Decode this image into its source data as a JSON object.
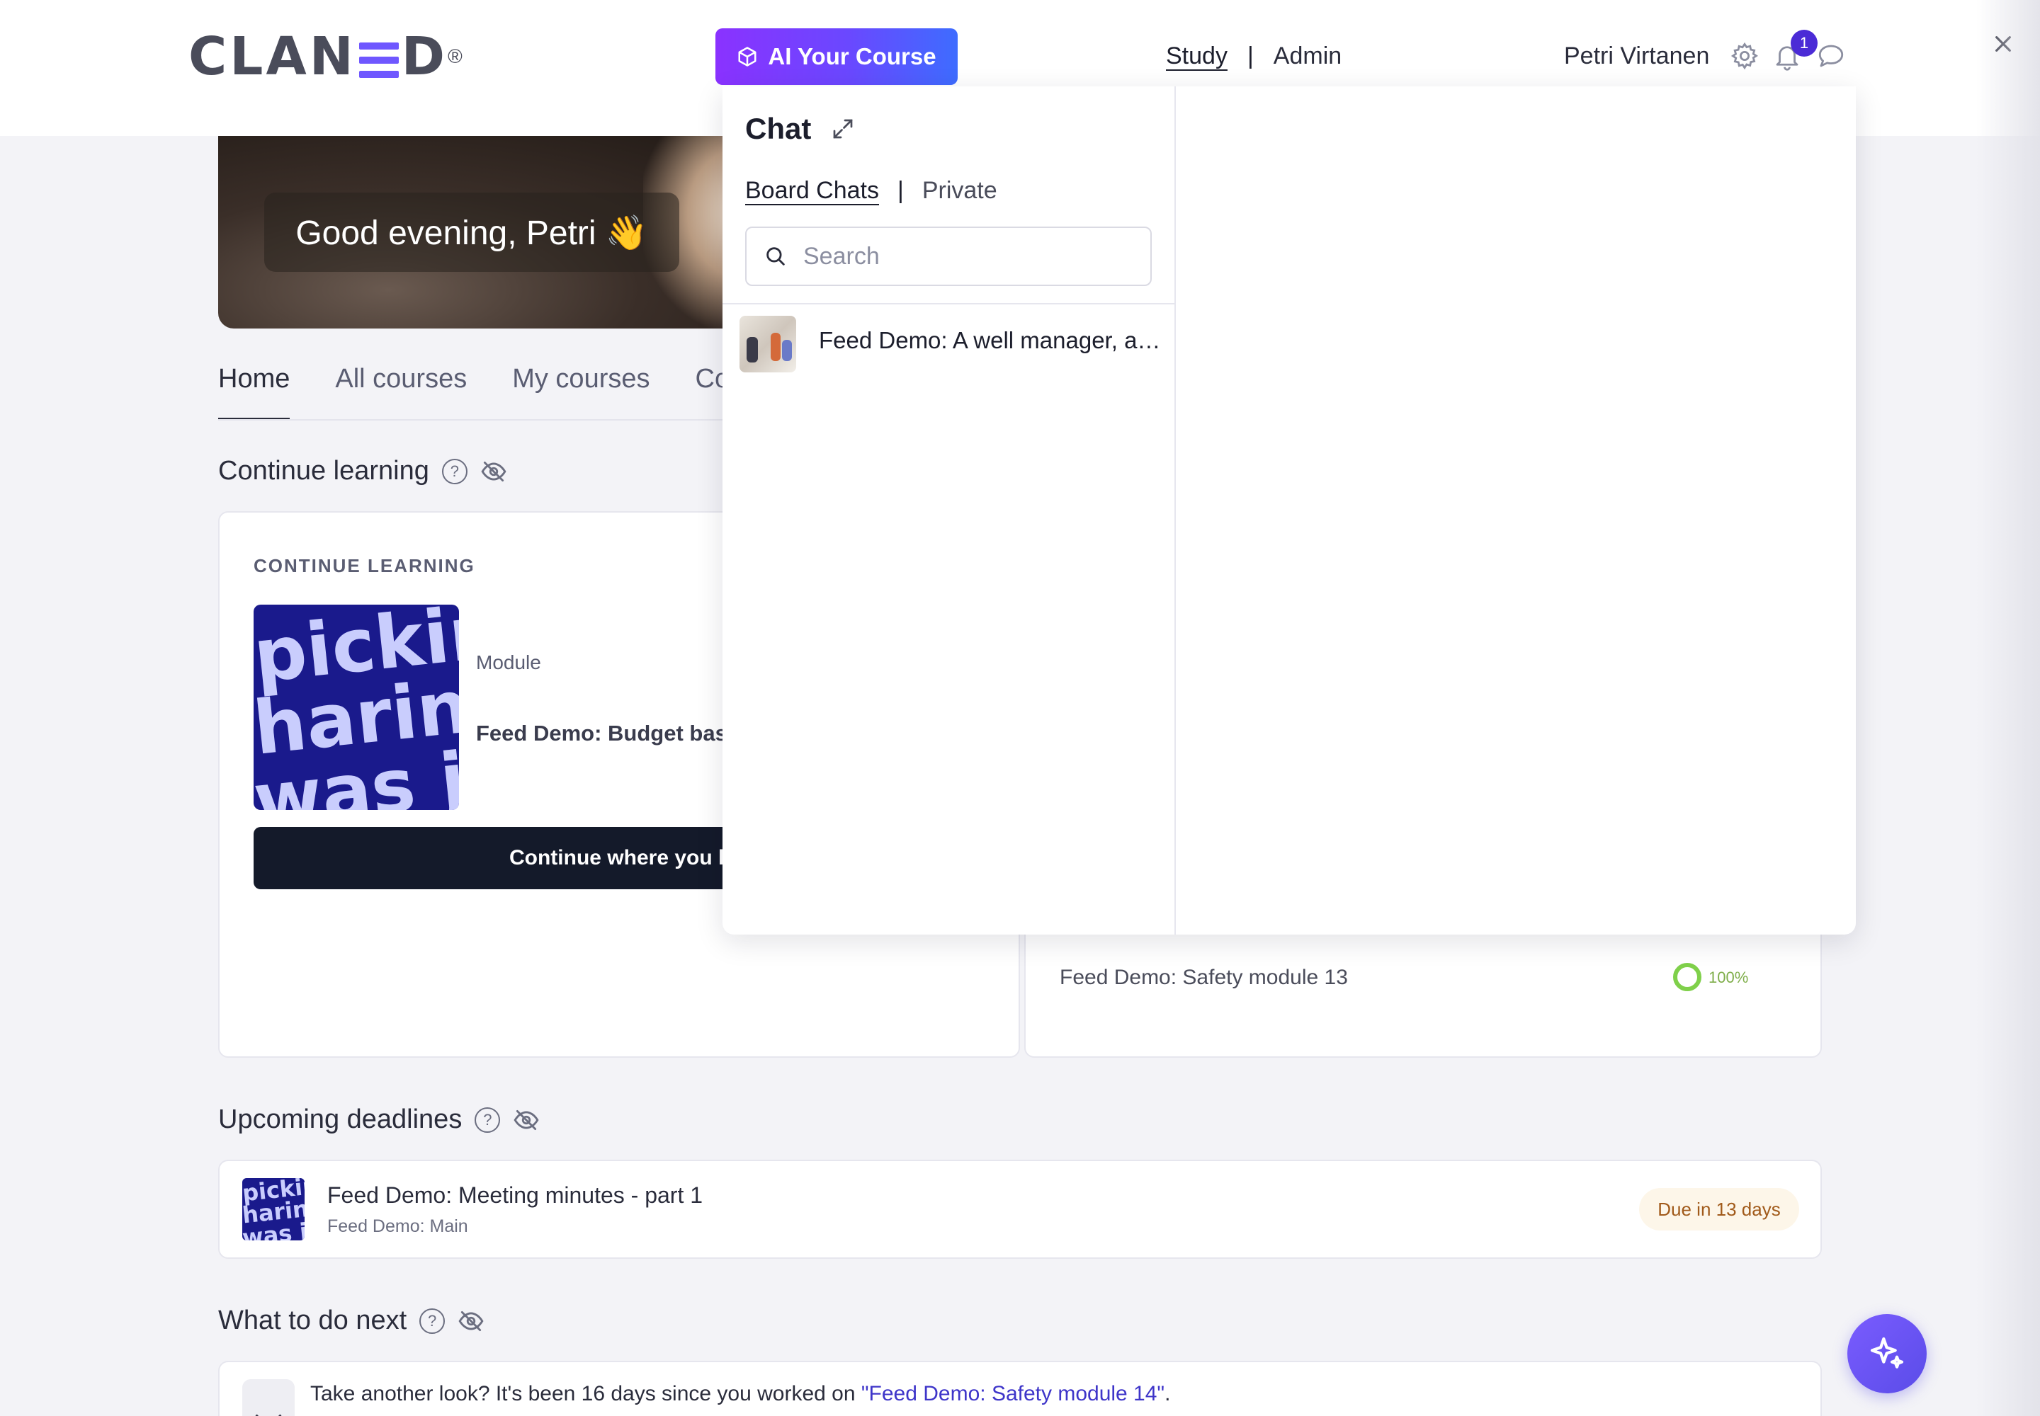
{
  "header": {
    "logo_text_left": "CLAN",
    "logo_text_right": "D",
    "logo_reg": "®",
    "ai_button_label": "AI Your Course",
    "nav": {
      "study": "Study",
      "separator": "|",
      "admin": "Admin"
    },
    "user_name": "Petri Virtanen",
    "notification_count": "1",
    "icons": [
      "gear-icon",
      "bell-icon",
      "chat-bubble-icon",
      "close-icon"
    ],
    "accent_color": "#6f57ff"
  },
  "hero": {
    "greeting": "Good evening, Petri 👋"
  },
  "tabs": [
    "Home",
    "All courses",
    "My courses",
    "Co"
  ],
  "continue_learning": {
    "section_title": "Continue learning",
    "card_label": "CONTINUE LEARNING",
    "thumbnail_lines": [
      "pickin",
      "harin",
      "was ju"
    ],
    "module_type": "Module",
    "module_name": "Feed Demo: Budget bas",
    "button_label": "Continue where you left"
  },
  "progress_card": {
    "item_name": "Feed Demo: Safety module 13",
    "progress": "100%",
    "progress_color": "#7fd04a"
  },
  "upcoming_deadlines": {
    "section_title": "Upcoming deadlines",
    "item_title": "Feed Demo: Meeting minutes - part 1",
    "item_subtitle": "Feed Demo: Main",
    "due_label": "Due in 13 days"
  },
  "what_next": {
    "section_title": "What to do next",
    "text_prefix": "Take another look? It's been 16 days since you worked on ",
    "link_text": "\"Feed Demo: Safety module 14\"",
    "text_suffix": "."
  },
  "help_glyph": "?",
  "chat": {
    "title": "Chat",
    "tabs": {
      "board": "Board Chats",
      "separator": "|",
      "private": "Private"
    },
    "search_placeholder": "Search",
    "items": [
      {
        "title": "Feed Demo: A well manager, a well-led team"
      }
    ]
  }
}
